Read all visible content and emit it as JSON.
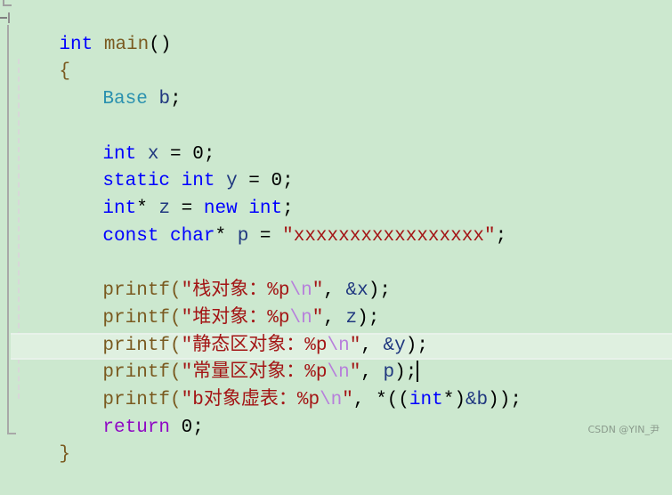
{
  "editor": {
    "lines": [
      {
        "tokens": [
          "int",
          " ",
          "main",
          "()"
        ]
      },
      {
        "tokens": [
          "{"
        ]
      },
      {
        "tokens": [
          "Base",
          " ",
          "b",
          ";"
        ]
      },
      {
        "tokens": []
      },
      {
        "tokens": [
          "int",
          " ",
          "x",
          " = ",
          "0",
          ";"
        ]
      },
      {
        "tokens": [
          "static",
          " ",
          "int",
          " ",
          "y",
          " = ",
          "0",
          ";"
        ]
      },
      {
        "tokens": [
          "int",
          "* ",
          "z",
          " = ",
          "new",
          " ",
          "int",
          ";"
        ]
      },
      {
        "tokens": [
          "const",
          " ",
          "char",
          "* ",
          "p",
          " = ",
          "\"xxxxxxxxxxxxxxxxx\"",
          ";"
        ]
      },
      {
        "tokens": []
      },
      {
        "tokens": [
          "printf",
          "(",
          "\"栈对象：%p",
          "\\n",
          "\"",
          ", ",
          "&x",
          ");"
        ]
      },
      {
        "tokens": [
          "printf",
          "(",
          "\"堆对象：%p",
          "\\n",
          "\"",
          ", ",
          "z",
          ");"
        ]
      },
      {
        "tokens": [
          "printf",
          "(",
          "\"静态区对象：%p",
          "\\n",
          "\"",
          ", ",
          "&y",
          ");"
        ]
      },
      {
        "tokens": [
          "printf",
          "(",
          "\"常量区对象：%p",
          "\\n",
          "\"",
          ", ",
          "p",
          ");"
        ]
      },
      {
        "tokens": [
          "printf",
          "(",
          "\"b对象虚表：%p",
          "\\n",
          "\"",
          ", *((",
          "int",
          "*)",
          "&b",
          "));"
        ]
      },
      {
        "tokens": [
          "return",
          " ",
          "0",
          ";"
        ]
      },
      {
        "tokens": [
          "}"
        ]
      }
    ],
    "current_line": 13
  },
  "watermark": "CSDN @YIN_尹"
}
